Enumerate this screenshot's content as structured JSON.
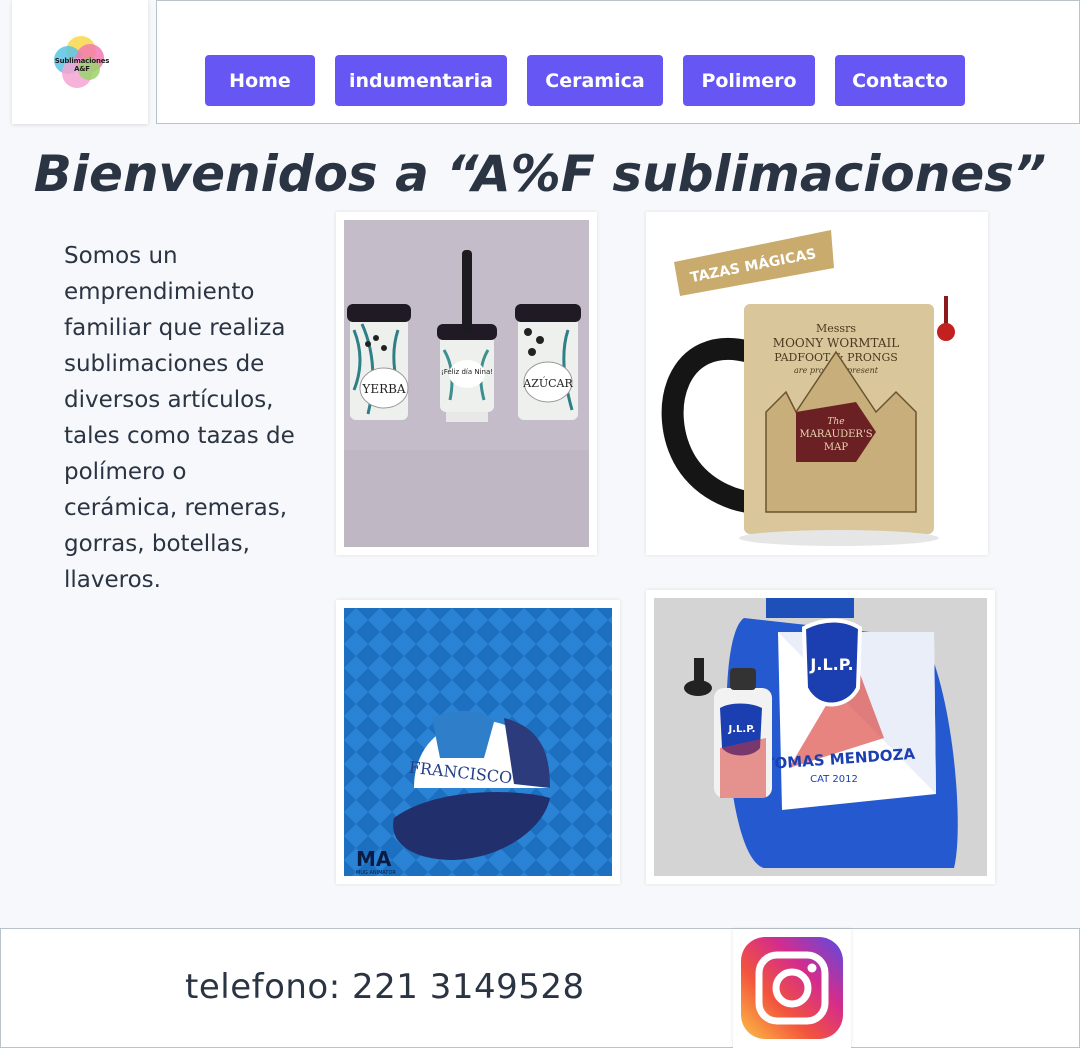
{
  "logo": {
    "text": "Sublimaciones A&F"
  },
  "nav": {
    "items": [
      {
        "label": "Home"
      },
      {
        "label": "indumentaria"
      },
      {
        "label": "Ceramica"
      },
      {
        "label": "Polimero"
      },
      {
        "label": "Contacto"
      }
    ]
  },
  "main": {
    "title": "Bienvenidos a “A%F sublimaciones”",
    "intro": "Somos un emprendimiento familiar que realiza sublimaciones de diversos artículos, tales como tazas de polímero o cerámica, remeras, gorras, botellas, llaveros.",
    "products": {
      "mates_labels": [
        "YERBA",
        "¡Feliz día Nina!",
        "AZÚCAR"
      ],
      "mug_banner": "TAZAS MÁGICAS",
      "mug_text_1": "Messrs",
      "mug_text_2": "MOONY WORMTAIL",
      "mug_text_3": "PADFOOT & PRONGS",
      "mug_text_4": "are proud to present",
      "mug_map_1": "The",
      "mug_map_2": "MARAUDER'S",
      "mug_map_3": "MAP",
      "cap_text": "FRANCISCO",
      "cap_brand": "MA",
      "cap_brand_sub": "MUG ANIMATOR",
      "bag_badge": "J.L.P.",
      "bag_name": "TOMAS MENDOZA",
      "bag_cat": "CAT 2012",
      "bottle_badge": "J.L.P."
    }
  },
  "footer": {
    "phone": "telefono: 221 3149528",
    "social": "instagram-icon"
  },
  "colors": {
    "accent": "#6657f5",
    "text": "#2a3442",
    "border": "#b9c3cc"
  }
}
